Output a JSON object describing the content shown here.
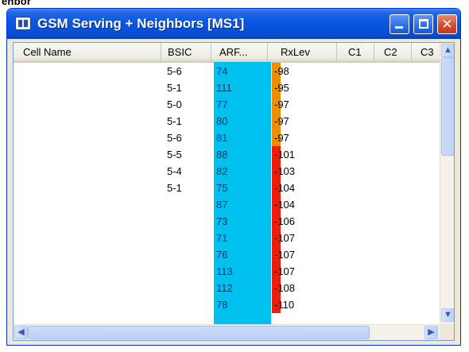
{
  "page": {
    "caption_fragment": "enbor"
  },
  "window": {
    "title": "GSM Serving + Neighbors [MS1]",
    "buttons": {
      "minimize": "minimize",
      "maximize": "maximize",
      "close": "✕"
    }
  },
  "table": {
    "columns": [
      "Cell Name",
      "BSIC",
      "ARF...",
      "RxLev",
      "C1",
      "C2",
      "C3"
    ],
    "rows": [
      {
        "cell_name": "",
        "bsic": "5-6",
        "arfcn": "74",
        "rxlev": "-98",
        "level": "medium"
      },
      {
        "cell_name": "",
        "bsic": "5-1",
        "arfcn": "111",
        "rxlev": "-95",
        "level": "medium"
      },
      {
        "cell_name": "",
        "bsic": "5-0",
        "arfcn": "77",
        "rxlev": "-97",
        "level": "medium"
      },
      {
        "cell_name": "",
        "bsic": "5-1",
        "arfcn": "80",
        "rxlev": "-97",
        "level": "medium"
      },
      {
        "cell_name": "",
        "bsic": "5-6",
        "arfcn": "81",
        "rxlev": "-97",
        "level": "medium"
      },
      {
        "cell_name": "",
        "bsic": "5-5",
        "arfcn": "88",
        "rxlev": "-101",
        "level": "low"
      },
      {
        "cell_name": "",
        "bsic": "5-4",
        "arfcn": "82",
        "rxlev": "-103",
        "level": "low"
      },
      {
        "cell_name": "",
        "bsic": "5-1",
        "arfcn": "75",
        "rxlev": "-104",
        "level": "low"
      },
      {
        "cell_name": "",
        "bsic": "",
        "arfcn": "87",
        "rxlev": "-104",
        "level": "low"
      },
      {
        "cell_name": "",
        "bsic": "",
        "arfcn": "73",
        "rxlev": "-106",
        "level": "low"
      },
      {
        "cell_name": "",
        "bsic": "",
        "arfcn": "71",
        "rxlev": "-107",
        "level": "low"
      },
      {
        "cell_name": "",
        "bsic": "",
        "arfcn": "76",
        "rxlev": "-107",
        "level": "low"
      },
      {
        "cell_name": "",
        "bsic": "",
        "arfcn": "113",
        "rxlev": "-107",
        "level": "low"
      },
      {
        "cell_name": "",
        "bsic": "",
        "arfcn": "112",
        "rxlev": "-108",
        "level": "low"
      },
      {
        "cell_name": "",
        "bsic": "",
        "arfcn": "78",
        "rxlev": "-110",
        "level": "low"
      }
    ]
  },
  "colors": {
    "arfcn_column": "#00c0f0",
    "rxlev_medium": "#f08c00",
    "rxlev_low": "#ee1c0a",
    "titlebar": "#0a5ae6"
  },
  "scrollbars": {
    "up_arrow": "▲",
    "down_arrow": "▼",
    "left_arrow": "◀",
    "right_arrow": "▶"
  }
}
